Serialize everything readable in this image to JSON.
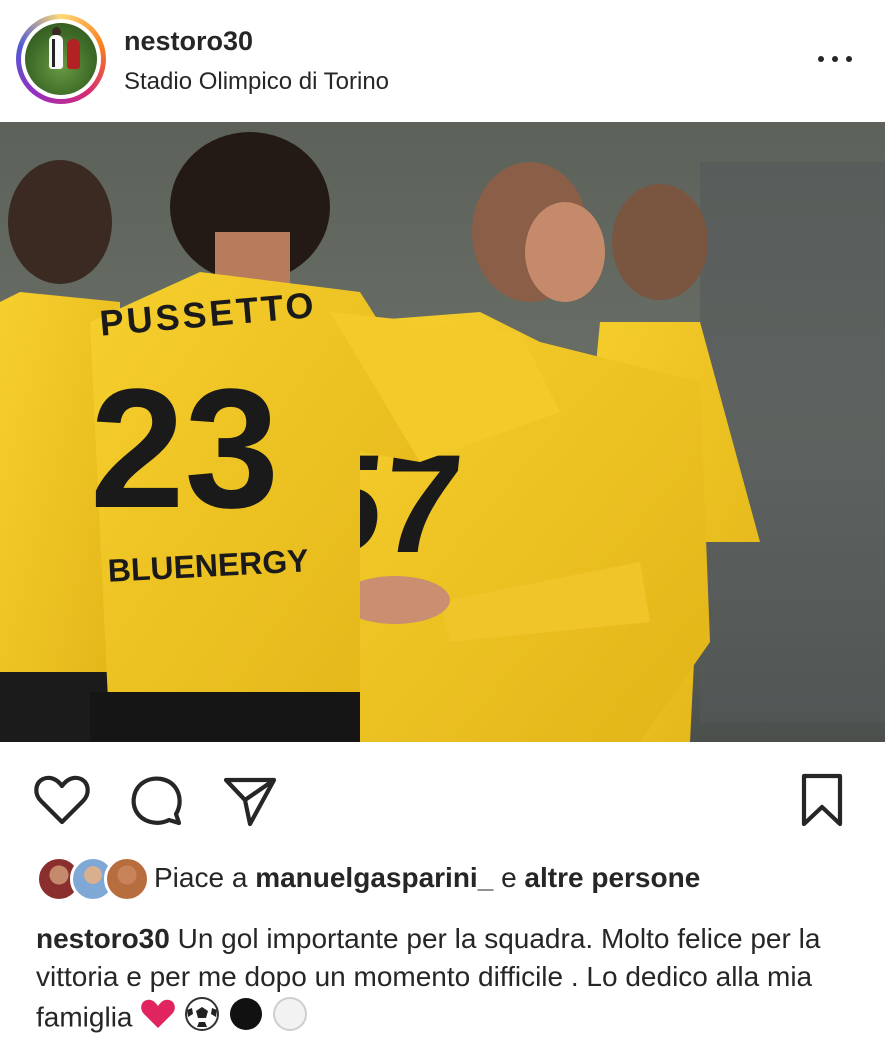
{
  "post": {
    "username": "nestoro30",
    "location": "Stadio Olimpico di Torino"
  },
  "photo": {
    "jersey_name": "PUSSETTO",
    "jersey_number": "23",
    "sponsor": "BLUENERGY",
    "second_number": "57"
  },
  "likes": {
    "prefix": "Piace a",
    "user": "manuelgasparini_",
    "conjunction": "e",
    "others": "altre persone"
  },
  "caption": {
    "username": "nestoro30",
    "text": "Un gol importante per la squadra. Molto felice per la vittoria e per me dopo un momento difficile . Lo dedico alla mia famiglia",
    "emojis": [
      "heart-emoji",
      "soccer-ball-emoji",
      "black-circle-emoji",
      "white-circle-emoji"
    ]
  },
  "icons": [
    "more-options-icon",
    "heart-icon",
    "comment-icon",
    "share-icon",
    "bookmark-icon"
  ],
  "colors": {
    "text": "#262626",
    "jersey_yellow": "#f2c51f",
    "heart_red": "#e0245e"
  }
}
